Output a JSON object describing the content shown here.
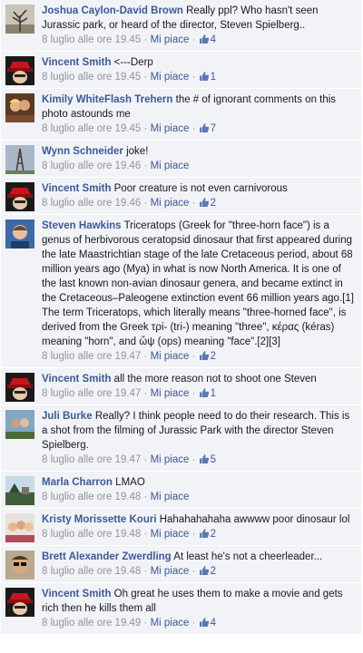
{
  "comments": [
    {
      "author": "Joshua Caylon-David Brown",
      "text": "Really ppl? Who hasn't seen Jurassic park, or heard of the director, Steven Spielberg..",
      "time": "8 luglio alle ore 19.45",
      "like_label": "Mi piace",
      "likes": "4",
      "avatar": "tree-avatar"
    },
    {
      "author": "Vincent Smith",
      "text": "<---Derp",
      "time": "8 luglio alle ore 19.45",
      "like_label": "Mi piace",
      "likes": "1",
      "avatar": "red-hat-avatar"
    },
    {
      "author": "Kimily WhiteFlash Trehern",
      "text": "the # of ignorant comments on this photo astounds me",
      "time": "8 luglio alle ore 19.45",
      "like_label": "Mi piace",
      "likes": "7",
      "avatar": "couple-avatar"
    },
    {
      "author": "Wynn Schneider",
      "text": "joke!",
      "time": "8 luglio alle ore 19.46",
      "like_label": "Mi piace",
      "likes": "",
      "avatar": "eiffel-avatar"
    },
    {
      "author": "Vincent Smith",
      "text": "Poor creature is not even carnivorous",
      "time": "8 luglio alle ore 19.46",
      "like_label": "Mi piace",
      "likes": "2",
      "avatar": "red-hat-avatar"
    },
    {
      "author": "Steven Hawkins",
      "text": "Triceratops (Greek for \"three-horn face\") is a genus of herbivorous ceratopsid dinosaur that first appeared during the late Maastrichtian stage of the late Cretaceous period, about 68 million years ago (Mya) in what is now North America. It is one of the last known non-avian dinosaur genera, and became extinct in the Cretaceous–Paleogene extinction event 66 million years ago.[1] The term Triceratops, which literally means \"three-horned face\", is derived from the Greek τρί- (tri-) meaning \"three\", κέρας (kéras) meaning \"horn\", and ὤψ (ops) meaning \"face\".[2][3]",
      "time": "8 luglio alle ore 19.47",
      "like_label": "Mi piace",
      "likes": "2",
      "avatar": "man-avatar"
    },
    {
      "author": "Vincent Smith",
      "text": "all the more reason not to shoot one Steven",
      "time": "8 luglio alle ore 19.47",
      "like_label": "Mi piace",
      "likes": "1",
      "avatar": "red-hat-avatar"
    },
    {
      "author": "Juli Burke",
      "text": "Really? I think people need to do their research. This is a shot from the filming of Jurassic Park with the director Steven Spielberg.",
      "time": "8 luglio alle ore 19.47",
      "like_label": "Mi piace",
      "likes": "5",
      "avatar": "selfie-avatar"
    },
    {
      "author": "Marla Charron",
      "text": "LMAO",
      "time": "8 luglio alle ore 19.48",
      "like_label": "Mi piace",
      "likes": "",
      "avatar": "landscape-avatar"
    },
    {
      "author": "Kristy Morissette Kouri",
      "text": "Hahahahahaha awwww poor dinosaur lol",
      "time": "8 luglio alle ore 19.48",
      "like_label": "Mi piace",
      "likes": "2",
      "avatar": "group-avatar"
    },
    {
      "author": "Brett Alexander Zwerdling",
      "text": "At least he's not a cheerleader...",
      "time": "8 luglio alle ore 19.48",
      "like_label": "Mi piace",
      "likes": "2",
      "avatar": "sunglasses-avatar"
    },
    {
      "author": "Vincent Smith",
      "text": "Oh great he uses them to make a movie and gets rich then he kills them all",
      "time": "8 luglio alle ore 19.49",
      "like_label": "Mi piace",
      "likes": "4",
      "avatar": "red-hat-avatar"
    }
  ],
  "colors": {
    "link": "#3b5998",
    "meta": "#90949c",
    "row_bg": "#f2f3f7"
  }
}
